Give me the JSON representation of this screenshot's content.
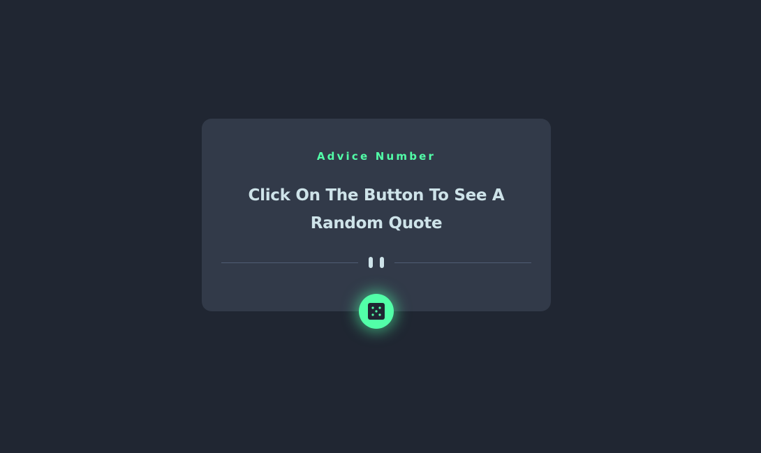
{
  "card": {
    "heading": "Advice Number",
    "quote": "Click On The Button To See A Random Quote"
  },
  "icons": {
    "divider": "pause-icon",
    "button": "dice-icon"
  },
  "colors": {
    "background": "#202632",
    "card": "#323a49",
    "accent": "#52ffa8",
    "text": "#cee3e9",
    "divider": "#4f5d74"
  }
}
